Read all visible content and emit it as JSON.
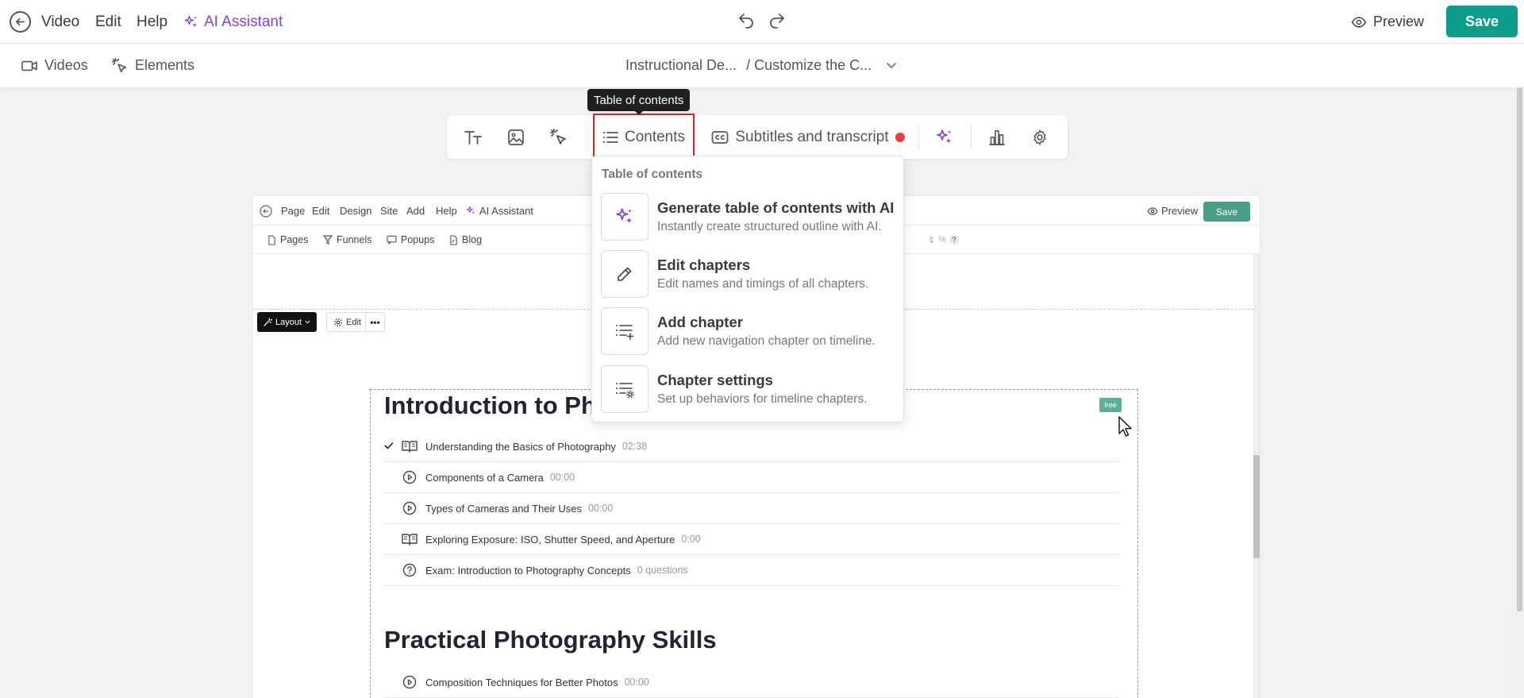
{
  "topbar": {
    "video": "Video",
    "edit": "Edit",
    "help": "Help",
    "ai_assistant": "AI Assistant",
    "preview": "Preview",
    "save": "Save"
  },
  "subbar": {
    "videos": "Videos",
    "elements": "Elements",
    "crumb_part1": "Instructional De...",
    "crumb_part2": "/ Customize the C..."
  },
  "toolbar": {
    "contents": "Contents",
    "subtitles": "Subtitles and transcript",
    "tooltip": "Table of contents"
  },
  "dropdown": {
    "header": "Table of contents",
    "items": [
      {
        "title": "Generate table of contents with AI",
        "desc": "Instantly create structured outline with AI."
      },
      {
        "title": "Edit chapters",
        "desc": "Edit names and timings of all chapters."
      },
      {
        "title": "Add chapter",
        "desc": "Add new navigation chapter on timeline."
      },
      {
        "title": "Chapter settings",
        "desc": "Set up behaviors for timeline chapters."
      }
    ]
  },
  "page_editor": {
    "topbar": {
      "page": "Page",
      "edit": "Edit",
      "design": "Design",
      "site": "Site",
      "add": "Add",
      "help": "Help",
      "ai_assistant": "AI Assistant",
      "preview": "Preview",
      "save": "Save"
    },
    "subbar": {
      "pages": "Pages",
      "funnels": "Funnels",
      "popups": "Popups",
      "blog": "Blog",
      "zoom_unit": "%",
      "help_badge": "?"
    },
    "block_controls": {
      "layout": "Layout",
      "edit": "Edit",
      "more": "•••"
    }
  },
  "course": {
    "section1_title": "Introduction to Ph",
    "free_badge": "free",
    "section1_lessons": [
      {
        "title": "Understanding the Basics of Photography",
        "meta": "02:38",
        "icon": "book",
        "completed": true
      },
      {
        "title": "Components of a Camera",
        "meta": "00:00",
        "icon": "play",
        "completed": false
      },
      {
        "title": "Types of Cameras and Their Uses",
        "meta": "00:00",
        "icon": "play",
        "completed": false
      },
      {
        "title": "Exploring Exposure: ISO, Shutter Speed, and Aperture",
        "meta": "0:00",
        "icon": "book",
        "completed": false
      },
      {
        "title": "Exam: Introduction to Photography Concepts",
        "meta": "0 questions",
        "icon": "question",
        "completed": false
      }
    ],
    "section2_title": "Practical Photography Skills",
    "section2_lessons": [
      {
        "title": "Composition Techniques for Better Photos",
        "meta": "00:00",
        "icon": "play",
        "completed": false
      }
    ]
  },
  "colors": {
    "accent": "#0e9d8b",
    "ai_purple": "#8b3fd9",
    "record_red": "#ef3b3b",
    "highlight_red": "#e02020",
    "inner_save": "#4a9d87"
  }
}
